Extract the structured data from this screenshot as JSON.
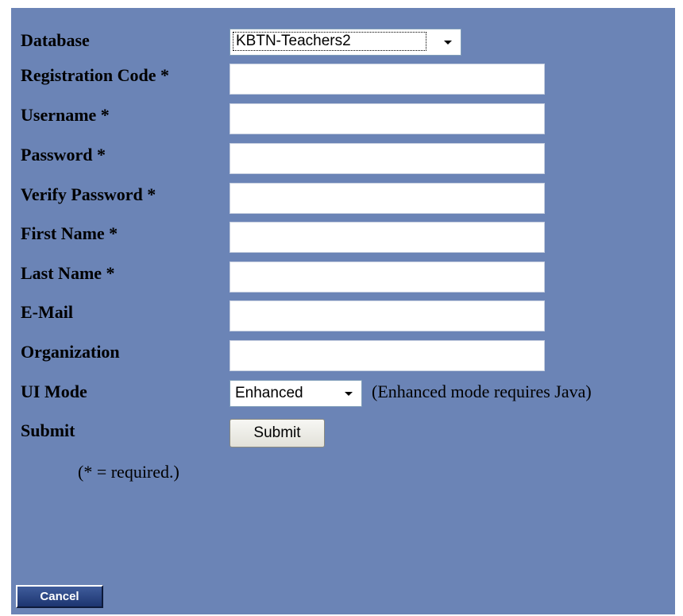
{
  "form": {
    "database": {
      "label": "Database",
      "selected": "KBTN-Teachers2"
    },
    "registration_code": {
      "label": "Registration Code *",
      "value": ""
    },
    "username": {
      "label": "Username *",
      "value": ""
    },
    "password": {
      "label": "Password *",
      "value": ""
    },
    "verify_password": {
      "label": "Verify Password *",
      "value": ""
    },
    "first_name": {
      "label": "First Name *",
      "value": ""
    },
    "last_name": {
      "label": "Last Name *",
      "value": ""
    },
    "email": {
      "label": "E-Mail",
      "value": ""
    },
    "organization": {
      "label": "Organization",
      "value": ""
    },
    "ui_mode": {
      "label": "UI Mode",
      "selected": "Enhanced",
      "note": "(Enhanced mode requires Java)"
    },
    "submit": {
      "label": "Submit",
      "button_label": "Submit"
    },
    "required_note": "(* = required.)"
  },
  "cancel_button_label": "Cancel",
  "colors": {
    "panel_background": "#6b84b6",
    "cancel_button": "#2a4484"
  }
}
